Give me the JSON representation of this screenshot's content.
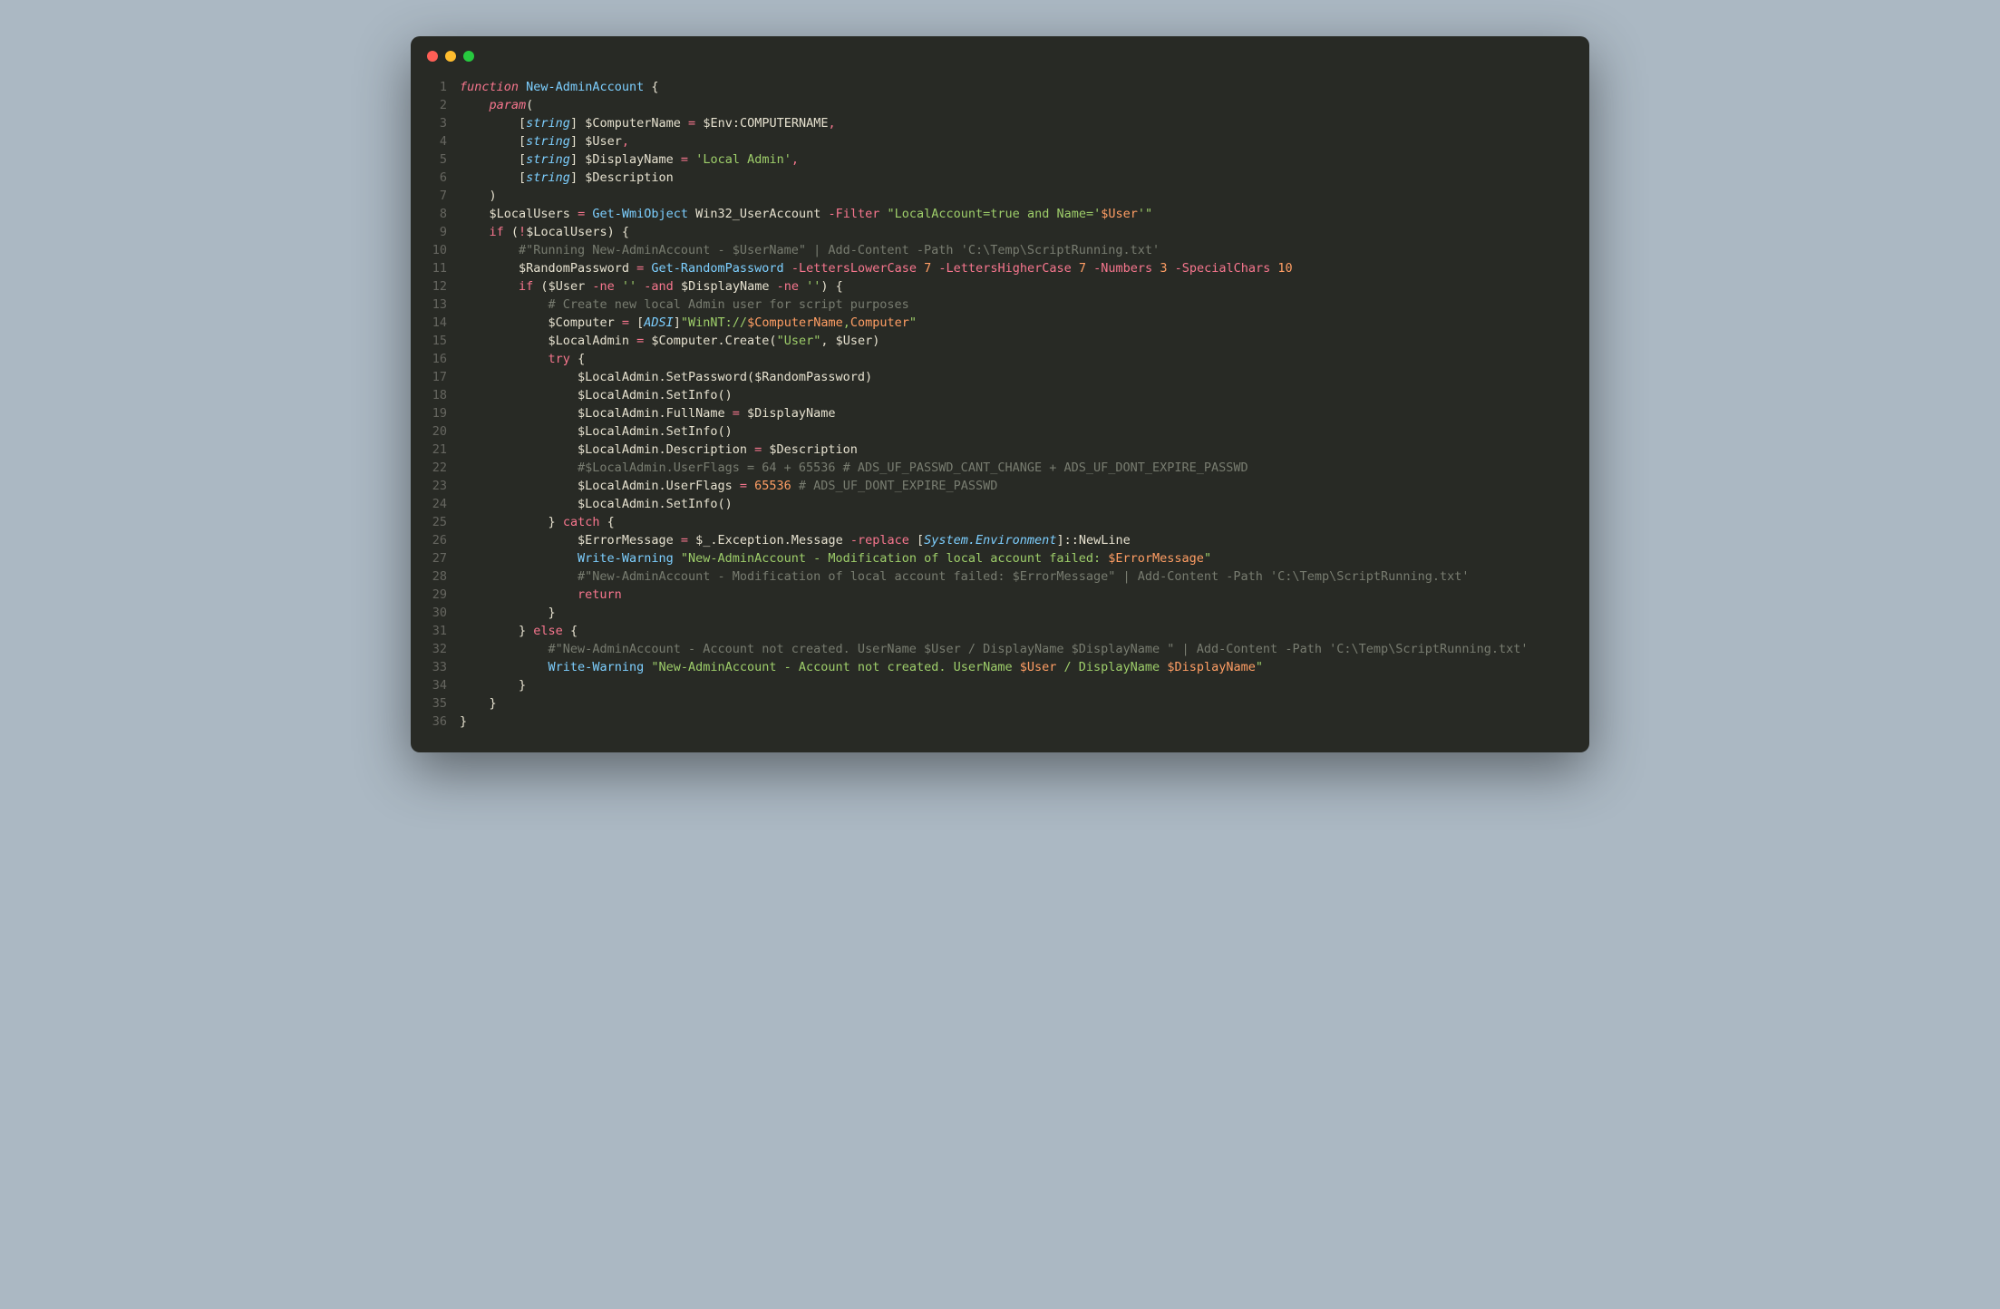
{
  "traffic_lights": {
    "close": "#ff5f56",
    "minimize": "#ffbd2e",
    "maximize": "#27c93f"
  },
  "language": "powershell",
  "colors": {
    "bg": "#282a25",
    "gutter": "#666660",
    "default": "#e6e1cf",
    "keyword": "#f7768e",
    "function": "#7dcfff",
    "string": "#9ece6a",
    "number": "#ff9e64",
    "comment": "#787c70"
  },
  "code": {
    "lines": [
      {
        "n": 1,
        "indent": 0,
        "tokens": [
          [
            "kw",
            "function"
          ],
          [
            "punct",
            " "
          ],
          [
            "func",
            "New-AdminAccount"
          ],
          [
            "punct",
            " {"
          ]
        ]
      },
      {
        "n": 2,
        "indent": 4,
        "tokens": [
          [
            "kw",
            "param"
          ],
          [
            "punct",
            "("
          ]
        ]
      },
      {
        "n": 3,
        "indent": 8,
        "tokens": [
          [
            "punct",
            "["
          ],
          [
            "type",
            "string"
          ],
          [
            "punct",
            "] "
          ],
          [
            "var",
            "$ComputerName"
          ],
          [
            "punct",
            " "
          ],
          [
            "op",
            "="
          ],
          [
            "punct",
            " "
          ],
          [
            "var",
            "$Env:COMPUTERNAME"
          ],
          [
            "op",
            ","
          ]
        ]
      },
      {
        "n": 4,
        "indent": 8,
        "tokens": [
          [
            "punct",
            "["
          ],
          [
            "type",
            "string"
          ],
          [
            "punct",
            "] "
          ],
          [
            "var",
            "$User"
          ],
          [
            "op",
            ","
          ]
        ]
      },
      {
        "n": 5,
        "indent": 8,
        "tokens": [
          [
            "punct",
            "["
          ],
          [
            "type",
            "string"
          ],
          [
            "punct",
            "] "
          ],
          [
            "var",
            "$DisplayName"
          ],
          [
            "punct",
            " "
          ],
          [
            "op",
            "="
          ],
          [
            "punct",
            " "
          ],
          [
            "str",
            "'Local Admin'"
          ],
          [
            "op",
            ","
          ]
        ]
      },
      {
        "n": 6,
        "indent": 8,
        "tokens": [
          [
            "punct",
            "["
          ],
          [
            "type",
            "string"
          ],
          [
            "punct",
            "] "
          ],
          [
            "var",
            "$Description"
          ]
        ]
      },
      {
        "n": 7,
        "indent": 4,
        "tokens": [
          [
            "punct",
            ")"
          ]
        ]
      },
      {
        "n": 8,
        "indent": 4,
        "tokens": [
          [
            "var",
            "$LocalUsers"
          ],
          [
            "punct",
            " "
          ],
          [
            "op",
            "="
          ],
          [
            "punct",
            " "
          ],
          [
            "func",
            "Get-WmiObject"
          ],
          [
            "punct",
            " "
          ],
          [
            "var",
            "Win32_UserAccount"
          ],
          [
            "punct",
            " "
          ],
          [
            "param",
            "-Filter"
          ],
          [
            "punct",
            " "
          ],
          [
            "str",
            "\"LocalAccount=true and Name='"
          ],
          [
            "strvar",
            "$User"
          ],
          [
            "str",
            "'\""
          ]
        ]
      },
      {
        "n": 9,
        "indent": 4,
        "tokens": [
          [
            "kw2",
            "if"
          ],
          [
            "punct",
            " ("
          ],
          [
            "op",
            "!"
          ],
          [
            "var",
            "$LocalUsers"
          ],
          [
            "punct",
            ") {"
          ]
        ]
      },
      {
        "n": 10,
        "indent": 8,
        "tokens": [
          [
            "cmt",
            "#\"Running New-AdminAccount - $UserName\" | Add-Content -Path 'C:\\Temp\\ScriptRunning.txt'"
          ]
        ]
      },
      {
        "n": 11,
        "indent": 8,
        "tokens": [
          [
            "var",
            "$RandomPassword"
          ],
          [
            "punct",
            " "
          ],
          [
            "op",
            "="
          ],
          [
            "punct",
            " "
          ],
          [
            "func",
            "Get-RandomPassword"
          ],
          [
            "punct",
            " "
          ],
          [
            "param",
            "-LettersLowerCase"
          ],
          [
            "punct",
            " "
          ],
          [
            "num",
            "7"
          ],
          [
            "punct",
            " "
          ],
          [
            "param",
            "-LettersHigherCase"
          ],
          [
            "punct",
            " "
          ],
          [
            "num",
            "7"
          ],
          [
            "punct",
            " "
          ],
          [
            "param",
            "-Numbers"
          ],
          [
            "punct",
            " "
          ],
          [
            "num",
            "3"
          ],
          [
            "punct",
            " "
          ],
          [
            "param",
            "-SpecialChars"
          ],
          [
            "punct",
            " "
          ],
          [
            "num",
            "10"
          ]
        ]
      },
      {
        "n": 12,
        "indent": 8,
        "tokens": [
          [
            "kw2",
            "if"
          ],
          [
            "punct",
            " ("
          ],
          [
            "var",
            "$User"
          ],
          [
            "punct",
            " "
          ],
          [
            "op",
            "-ne"
          ],
          [
            "punct",
            " "
          ],
          [
            "str",
            "''"
          ],
          [
            "punct",
            " "
          ],
          [
            "op",
            "-and"
          ],
          [
            "punct",
            " "
          ],
          [
            "var",
            "$DisplayName"
          ],
          [
            "punct",
            " "
          ],
          [
            "op",
            "-ne"
          ],
          [
            "punct",
            " "
          ],
          [
            "str",
            "''"
          ],
          [
            "punct",
            ") {"
          ]
        ]
      },
      {
        "n": 13,
        "indent": 12,
        "tokens": [
          [
            "cmt",
            "# Create new local Admin user for script purposes"
          ]
        ]
      },
      {
        "n": 14,
        "indent": 12,
        "tokens": [
          [
            "var",
            "$Computer"
          ],
          [
            "punct",
            " "
          ],
          [
            "op",
            "="
          ],
          [
            "punct",
            " ["
          ],
          [
            "type",
            "ADSI"
          ],
          [
            "punct",
            "]"
          ],
          [
            "str",
            "\"WinNT://"
          ],
          [
            "strvar",
            "$ComputerName"
          ],
          [
            "str",
            ","
          ],
          [
            "strvar",
            "Computer"
          ],
          [
            "str",
            "\""
          ]
        ]
      },
      {
        "n": 15,
        "indent": 12,
        "tokens": [
          [
            "var",
            "$LocalAdmin"
          ],
          [
            "punct",
            " "
          ],
          [
            "op",
            "="
          ],
          [
            "punct",
            " "
          ],
          [
            "var",
            "$Computer"
          ],
          [
            "punct",
            ".Create("
          ],
          [
            "str",
            "\"User\""
          ],
          [
            "punct",
            ", "
          ],
          [
            "var",
            "$User"
          ],
          [
            "punct",
            ")"
          ]
        ]
      },
      {
        "n": 16,
        "indent": 12,
        "tokens": [
          [
            "kw2",
            "try"
          ],
          [
            "punct",
            " {"
          ]
        ]
      },
      {
        "n": 17,
        "indent": 16,
        "tokens": [
          [
            "var",
            "$LocalAdmin"
          ],
          [
            "punct",
            ".SetPassword("
          ],
          [
            "var",
            "$RandomPassword"
          ],
          [
            "punct",
            ")"
          ]
        ]
      },
      {
        "n": 18,
        "indent": 16,
        "tokens": [
          [
            "var",
            "$LocalAdmin"
          ],
          [
            "punct",
            ".SetInfo()"
          ]
        ]
      },
      {
        "n": 19,
        "indent": 16,
        "tokens": [
          [
            "var",
            "$LocalAdmin"
          ],
          [
            "punct",
            ".FullName "
          ],
          [
            "op",
            "="
          ],
          [
            "punct",
            " "
          ],
          [
            "var",
            "$DisplayName"
          ]
        ]
      },
      {
        "n": 20,
        "indent": 16,
        "tokens": [
          [
            "var",
            "$LocalAdmin"
          ],
          [
            "punct",
            ".SetInfo()"
          ]
        ]
      },
      {
        "n": 21,
        "indent": 16,
        "tokens": [
          [
            "var",
            "$LocalAdmin"
          ],
          [
            "punct",
            ".Description "
          ],
          [
            "op",
            "="
          ],
          [
            "punct",
            " "
          ],
          [
            "var",
            "$Description"
          ]
        ]
      },
      {
        "n": 22,
        "indent": 16,
        "tokens": [
          [
            "cmt",
            "#$LocalAdmin.UserFlags = 64 + 65536 # ADS_UF_PASSWD_CANT_CHANGE + ADS_UF_DONT_EXPIRE_PASSWD"
          ]
        ]
      },
      {
        "n": 23,
        "indent": 16,
        "tokens": [
          [
            "var",
            "$LocalAdmin"
          ],
          [
            "punct",
            ".UserFlags "
          ],
          [
            "op",
            "="
          ],
          [
            "punct",
            " "
          ],
          [
            "num",
            "65536"
          ],
          [
            "punct",
            " "
          ],
          [
            "cmt",
            "# ADS_UF_DONT_EXPIRE_PASSWD"
          ]
        ]
      },
      {
        "n": 24,
        "indent": 16,
        "tokens": [
          [
            "var",
            "$LocalAdmin"
          ],
          [
            "punct",
            ".SetInfo()"
          ]
        ]
      },
      {
        "n": 25,
        "indent": 12,
        "tokens": [
          [
            "punct",
            "} "
          ],
          [
            "kw2",
            "catch"
          ],
          [
            "punct",
            " {"
          ]
        ]
      },
      {
        "n": 26,
        "indent": 16,
        "tokens": [
          [
            "var",
            "$ErrorMessage"
          ],
          [
            "punct",
            " "
          ],
          [
            "op",
            "="
          ],
          [
            "punct",
            " "
          ],
          [
            "var",
            "$_"
          ],
          [
            "punct",
            ".Exception.Message "
          ],
          [
            "op",
            "-replace"
          ],
          [
            "punct",
            " ["
          ],
          [
            "type",
            "System.Environment"
          ],
          [
            "punct",
            "]::NewLine"
          ]
        ]
      },
      {
        "n": 27,
        "indent": 16,
        "tokens": [
          [
            "func",
            "Write-Warning"
          ],
          [
            "punct",
            " "
          ],
          [
            "str",
            "\"New-AdminAccount - Modification of local account failed: "
          ],
          [
            "strvar",
            "$ErrorMessage"
          ],
          [
            "str",
            "\""
          ]
        ]
      },
      {
        "n": 28,
        "indent": 16,
        "tokens": [
          [
            "cmt",
            "#\"New-AdminAccount - Modification of local account failed: $ErrorMessage\" | Add-Content -Path 'C:\\Temp\\ScriptRunning.txt'"
          ]
        ]
      },
      {
        "n": 29,
        "indent": 16,
        "tokens": [
          [
            "kw2",
            "return"
          ]
        ]
      },
      {
        "n": 30,
        "indent": 12,
        "tokens": [
          [
            "punct",
            "}"
          ]
        ]
      },
      {
        "n": 31,
        "indent": 8,
        "tokens": [
          [
            "punct",
            "} "
          ],
          [
            "kw2",
            "else"
          ],
          [
            "punct",
            " {"
          ]
        ]
      },
      {
        "n": 32,
        "indent": 12,
        "tokens": [
          [
            "cmt",
            "#\"New-AdminAccount - Account not created. UserName $User / DisplayName $DisplayName \" | Add-Content -Path 'C:\\Temp\\ScriptRunning.txt'"
          ]
        ]
      },
      {
        "n": 33,
        "indent": 12,
        "tokens": [
          [
            "func",
            "Write-Warning"
          ],
          [
            "punct",
            " "
          ],
          [
            "str",
            "\"New-AdminAccount - Account not created. UserName "
          ],
          [
            "strvar",
            "$User"
          ],
          [
            "str",
            " / DisplayName "
          ],
          [
            "strvar",
            "$DisplayName"
          ],
          [
            "str",
            "\""
          ]
        ]
      },
      {
        "n": 34,
        "indent": 8,
        "tokens": [
          [
            "punct",
            "}"
          ]
        ]
      },
      {
        "n": 35,
        "indent": 4,
        "tokens": [
          [
            "punct",
            "}"
          ]
        ]
      },
      {
        "n": 36,
        "indent": 0,
        "tokens": [
          [
            "punct",
            "}"
          ]
        ]
      }
    ]
  }
}
